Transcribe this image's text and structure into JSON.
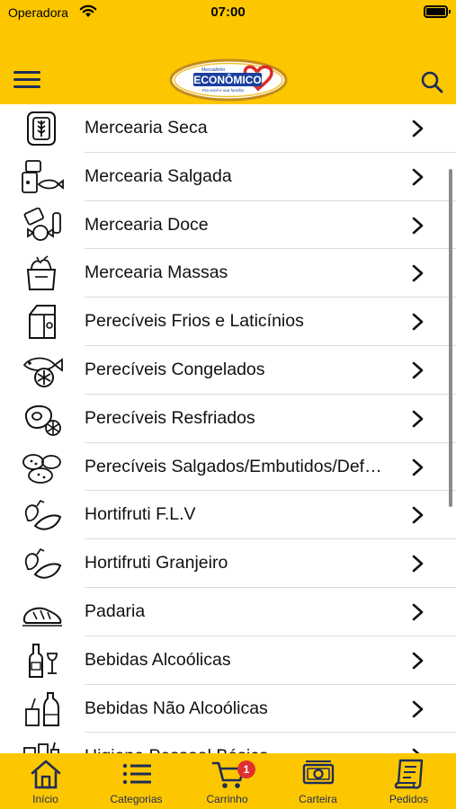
{
  "status": {
    "carrier": "Operadora",
    "time": "07:00"
  },
  "header": {
    "menu_icon": "hamburger-icon",
    "search_icon": "search-icon",
    "logo": {
      "small_text": "Mercadinho",
      "brand": "ECONÔMICO",
      "tagline": "Pra você e sua família!"
    }
  },
  "categories": [
    {
      "label": "Mercearia Seca",
      "icon": "grain-jar-icon"
    },
    {
      "label": "Mercearia Salgada",
      "icon": "canned-fish-icon"
    },
    {
      "label": "Mercearia Doce",
      "icon": "candy-icon"
    },
    {
      "label": "Mercearia Massas",
      "icon": "grocery-bag-icon"
    },
    {
      "label": "Perecíveis Frios e Laticínios",
      "icon": "milk-carton-icon"
    },
    {
      "label": "Perecíveis Congelados",
      "icon": "frozen-fish-icon"
    },
    {
      "label": "Perecíveis Resfriados",
      "icon": "meat-snowflake-icon"
    },
    {
      "label": "Perecíveis Salgados/Embutidos/Defumados",
      "icon": "sausage-icon"
    },
    {
      "label": "Hortifruti F.L.V",
      "icon": "vegetables-icon"
    },
    {
      "label": "Hortifruti Granjeiro",
      "icon": "vegetables-icon"
    },
    {
      "label": "Padaria",
      "icon": "bread-icon"
    },
    {
      "label": "Bebidas Alcoólicas",
      "icon": "wine-bottle-icon"
    },
    {
      "label": "Bebidas Não Alcoólicas",
      "icon": "soda-bottle-icon"
    },
    {
      "label": "Higiene Pessoal Básica",
      "icon": "hygiene-icon"
    }
  ],
  "tabs": [
    {
      "label": "Início",
      "icon": "home-icon"
    },
    {
      "label": "Categorias",
      "icon": "list-icon"
    },
    {
      "label": "Carrinho",
      "icon": "cart-icon",
      "badge": "1"
    },
    {
      "label": "Carteira",
      "icon": "money-icon"
    },
    {
      "label": "Pedidos",
      "icon": "receipt-icon"
    }
  ],
  "colors": {
    "header": "#FDC700",
    "tab_text": "#1f2d57",
    "badge": "#e03030"
  }
}
